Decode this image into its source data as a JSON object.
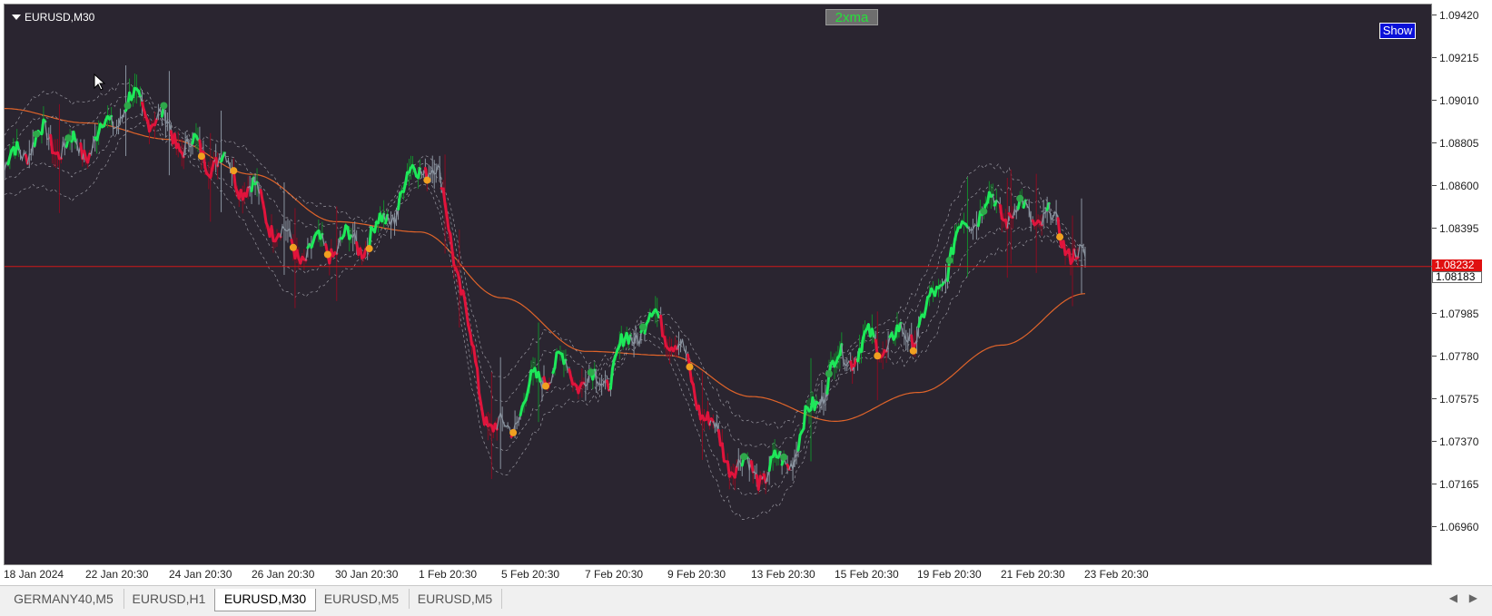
{
  "chart": {
    "symbol_title": "EURUSD,M30",
    "indicator_badge": "2xma",
    "show_button": "Show",
    "current_price_label": "1.08232",
    "bid_price_label": "1.08183",
    "price_scale": [
      "1.09420",
      "1.09215",
      "1.09010",
      "1.08805",
      "1.08600",
      "1.08395",
      "1.08183",
      "1.07985",
      "1.07780",
      "1.07575",
      "1.07370",
      "1.07165",
      "1.06960"
    ],
    "time_axis": [
      "18 Jan 2024",
      "22 Jan 20:30",
      "24 Jan 20:30",
      "26 Jan 20:30",
      "30 Jan 20:30",
      "1 Feb 20:30",
      "5 Feb 20:30",
      "7 Feb 20:30",
      "9 Feb 20:30",
      "13 Feb 20:30",
      "15 Feb 20:30",
      "19 Feb 20:30",
      "21 Feb 20:30",
      "23 Feb 20:30"
    ],
    "colors": {
      "background": "#2a2530",
      "up_trend": "#1ee85a",
      "down_trend": "#e0143c",
      "neutral": "#8a94a0",
      "slow_ma": "#e0642a",
      "price_line": "#d01818",
      "signal_up": "#2ea84a",
      "signal_down": "#f0a020"
    }
  },
  "tabs": [
    {
      "label": "GERMANY40,M5",
      "active": false
    },
    {
      "label": "EURUSD,H1",
      "active": false
    },
    {
      "label": "EURUSD,M30",
      "active": true
    },
    {
      "label": "EURUSD,M5",
      "active": false
    },
    {
      "label": "EURUSD,M5",
      "active": false
    }
  ],
  "chart_data": {
    "type": "line",
    "title": "",
    "xlabel": "",
    "ylabel": "",
    "ylim": [
      1.0686,
      1.0947
    ],
    "x": [
      "18 Jan 2024",
      "22 Jan 20:30",
      "24 Jan 20:30",
      "26 Jan 20:30",
      "30 Jan 20:30",
      "1 Feb 20:30",
      "5 Feb 20:30",
      "7 Feb 20:30",
      "9 Feb 20:30",
      "13 Feb 20:30",
      "15 Feb 20:30",
      "19 Feb 20:30",
      "21 Feb 20:30",
      "23 Feb 20:30"
    ],
    "series": [
      {
        "values": [
          1.087,
          1.089,
          1.0895,
          1.0855,
          1.0825,
          1.087,
          1.075,
          1.0775,
          1.079,
          1.0715,
          1.077,
          1.08,
          1.086,
          1.0823
        ]
      },
      {
        "values": [
          1.09,
          1.0893,
          1.0885,
          1.0868,
          1.0845,
          1.084,
          1.0808,
          1.0782,
          1.078,
          1.076,
          1.0748,
          1.0762,
          1.0785,
          1.081
        ]
      }
    ],
    "horizontal_line": 1.08232,
    "grid": false
  }
}
